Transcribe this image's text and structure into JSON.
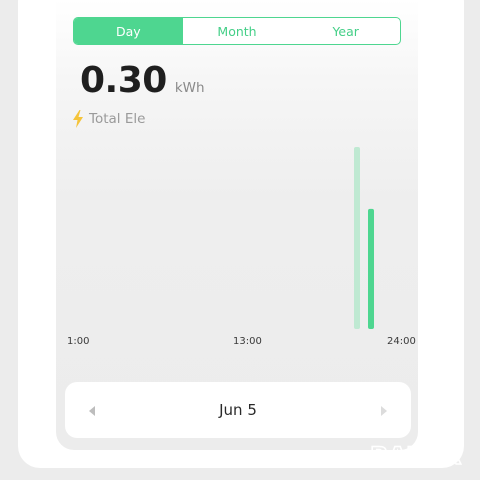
{
  "tabs": [
    {
      "label": "Day",
      "active": true
    },
    {
      "label": "Month",
      "active": false
    },
    {
      "label": "Year",
      "active": false
    }
  ],
  "summary": {
    "value": "0.30",
    "unit": "kWh",
    "label": "Total Ele"
  },
  "chart_data": {
    "type": "bar",
    "x_tick_labels": [
      "1:00",
      "13:00",
      "24:00"
    ],
    "x_ticks_hours": [
      1,
      13,
      24
    ],
    "series": [
      {
        "color": "#bfe9d2",
        "points": [
          {
            "x": 21,
            "y": 1.0
          }
        ]
      },
      {
        "color": "#4ed690",
        "points": [
          {
            "x": 22,
            "y": 0.66
          }
        ]
      }
    ],
    "ylim": [
      0,
      1
    ],
    "grid": false
  },
  "date_nav": {
    "date": "Jun 5",
    "prev_icon": "chevron-left-icon",
    "next_icon": "chevron-right-icon"
  },
  "colors": {
    "accent": "#4ed690",
    "accent_light": "#bfe9d2",
    "bolt": "#f5c43a"
  },
  "watermark_text": "BAZAR"
}
